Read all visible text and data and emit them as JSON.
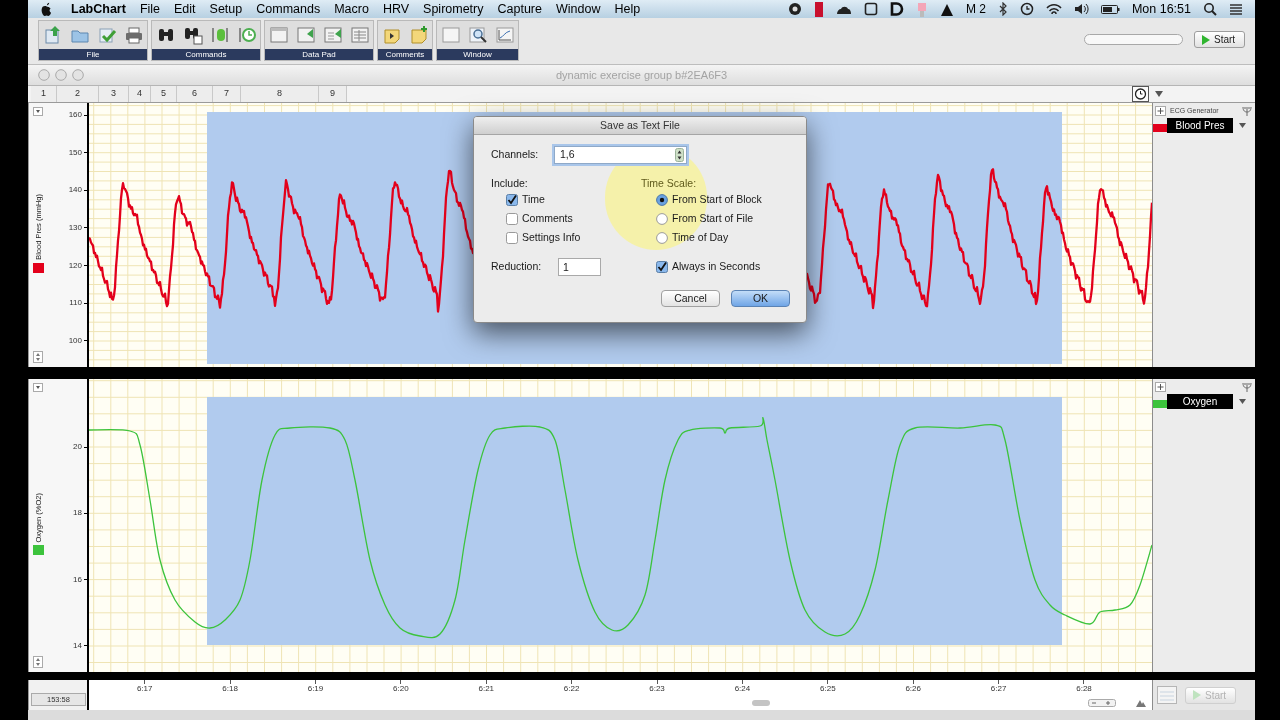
{
  "menu_bar": {
    "app_name": "LabChart",
    "menus": [
      "File",
      "Edit",
      "Setup",
      "Commands",
      "Macro",
      "HRV",
      "Spirometry",
      "Capture",
      "Window",
      "Help"
    ],
    "status_text": "M 2",
    "clock": "Mon 16:51"
  },
  "toolbar": {
    "groups": [
      {
        "label": "File"
      },
      {
        "label": "Commands"
      },
      {
        "label": "Data Pad"
      },
      {
        "label": "Comments"
      },
      {
        "label": "Window"
      }
    ],
    "start_button": {
      "label": "Start",
      "disabled": false
    }
  },
  "document_window": {
    "title": "dynamic exercise group b#2EA6F3",
    "markers": [
      "1",
      "2",
      "3",
      "4",
      "5",
      "6",
      "7",
      "8",
      "9"
    ]
  },
  "channels": [
    {
      "name": "Blood Pres",
      "source": "ECG Generator",
      "axis_title": "Blood Pres (mmHg)",
      "color": "#e3001b",
      "y_ticks": [
        "160",
        "150",
        "140",
        "130",
        "120",
        "110",
        "100"
      ]
    },
    {
      "name": "Oxygen",
      "axis_title": "Oxygen (%O2)",
      "color": "#3cc33c",
      "y_ticks": [
        "20",
        "18",
        "16",
        "14"
      ]
    }
  ],
  "time_axis": {
    "readout": "153:58",
    "ticks": [
      "6:17",
      "6:18",
      "6:19",
      "6:20",
      "6:21",
      "6:22",
      "6:23",
      "6:24",
      "6:25",
      "6:26",
      "6:27",
      "6:28"
    ],
    "start_button": {
      "label": "Start",
      "disabled": true
    }
  },
  "dialog": {
    "title": "Save as Text File",
    "channels_label": "Channels:",
    "channels_value": "1,6",
    "include_label": "Include:",
    "include_options": [
      {
        "label": "Time",
        "checked": true
      },
      {
        "label": "Comments",
        "checked": false
      },
      {
        "label": "Settings Info",
        "checked": false
      }
    ],
    "time_scale_label": "Time Scale:",
    "time_scale_options": [
      {
        "label": "From Start of Block",
        "selected": true
      },
      {
        "label": "From Start of File",
        "selected": false
      },
      {
        "label": "Time of Day",
        "selected": false
      }
    ],
    "reduction_label": "Reduction:",
    "reduction_value": "1",
    "always_in_seconds": {
      "label": "Always in Seconds",
      "checked": true
    },
    "buttons": [
      {
        "label": "Cancel",
        "default": false
      },
      {
        "label": "OK",
        "default": true
      }
    ]
  }
}
